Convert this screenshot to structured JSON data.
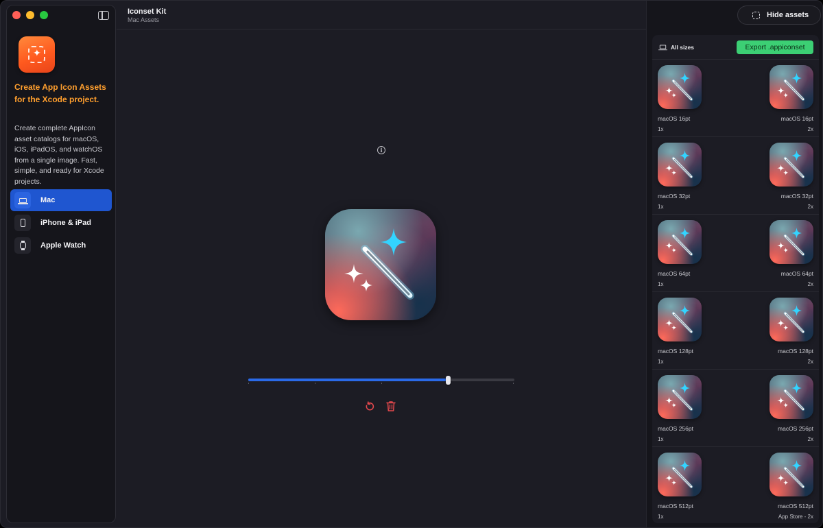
{
  "app": {
    "title": "Iconset Kit",
    "subtitle": "Mac Assets"
  },
  "sidebar": {
    "promo_title": "Create App Icon Assets for the Xcode project.",
    "promo_desc": "Create complete AppIcon asset catalogs for macOS, iOS, iPadOS, and watchOS from a single image. Fast, simple, and ready for Xcode projects.",
    "items": [
      {
        "label": "Mac",
        "icon": "laptop-icon",
        "active": true
      },
      {
        "label": "iPhone & iPad",
        "icon": "phone-icon",
        "active": false
      },
      {
        "label": "Apple Watch",
        "icon": "watch-icon",
        "active": false
      }
    ]
  },
  "preview": {
    "info_glyph": "i",
    "slider_value": 0.75
  },
  "right_panel": {
    "hide_label": "Hide assets",
    "all_sizes_label": "All sizes",
    "export_label": "Export .appiconset",
    "assets": [
      [
        {
          "label": "macOS 16pt",
          "scale": "1x"
        },
        {
          "label": "macOS 16pt",
          "scale": "2x"
        }
      ],
      [
        {
          "label": "macOS 32pt",
          "scale": "1x"
        },
        {
          "label": "macOS 32pt",
          "scale": "2x"
        }
      ],
      [
        {
          "label": "macOS 64pt",
          "scale": "1x"
        },
        {
          "label": "macOS 64pt",
          "scale": "2x"
        }
      ],
      [
        {
          "label": "macOS 128pt",
          "scale": "1x"
        },
        {
          "label": "macOS 128pt",
          "scale": "2x"
        }
      ],
      [
        {
          "label": "macOS 256pt",
          "scale": "1x"
        },
        {
          "label": "macOS 256pt",
          "scale": "2x"
        }
      ],
      [
        {
          "label": "macOS 512pt",
          "scale": "1x"
        },
        {
          "label": "macOS 512pt",
          "scale": "App Store - 2x"
        }
      ]
    ]
  },
  "colors": {
    "accent_blue": "#1f56d0",
    "promo_orange": "#ff9f2e",
    "export_green": "#3ccf74",
    "danger_red": "#e5484d"
  }
}
